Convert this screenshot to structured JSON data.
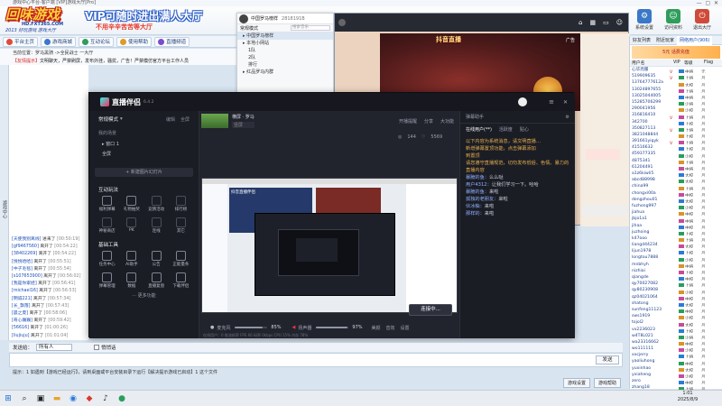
{
  "window": {
    "title": "游戏中心平台-客户端  [VIP]游戏大厅[Pro]"
  },
  "banner": {
    "logo_main": "回味游戏",
    "logo_url": "HD.FXT365.COM",
    "logo_slogan": "2013 好玩游戏 游戏大厅",
    "vip_line1": "VIP可随时进出满人大厅",
    "vip_line2": "不用辛辛苦苦等大厅"
  },
  "top_right": [
    {
      "label": "系统设置",
      "icon": "gear-icon",
      "color": "#3a78c8"
    },
    {
      "label": "访问资料",
      "icon": "user-icon",
      "color": "#2f9d5b"
    },
    {
      "label": "退出大厅",
      "icon": "exit-icon",
      "color": "#d04a3a"
    }
  ],
  "toolbar": [
    {
      "label": "平台主页",
      "color": "#e04a3a"
    },
    {
      "label": "游戏商城",
      "color": "#3a78c8"
    },
    {
      "label": "互动论坛",
      "color": "#2f9d5b"
    },
    {
      "label": "使用帮助",
      "color": "#e09a2a"
    },
    {
      "label": "直播频道",
      "color": "#7a4ad0"
    }
  ],
  "announce": {
    "prefix": "当前位置：",
    "location": "罗马黑骑 ->全民战士 一大厅",
    "notice_tag": "【友情提示】",
    "notice": "文明聊天，严禁刷屏，发布外挂，骚扰，广告！严禁模仿官方平台工作人员"
  },
  "left_label": "游戏中心",
  "chat_log": [
    {
      "name": "[天使我别离线]",
      "action": "进来了",
      "time": "[00:50:19]"
    },
    {
      "name": "[gf9467560]",
      "action": "离开了",
      "time": "[00:54:22]"
    },
    {
      "name": "[38402269]",
      "action": "离开了",
      "time": "[00:54:22]"
    },
    {
      "name": "[悦悦哈哈]",
      "action": "离开了",
      "time": "[00:55:51]"
    },
    {
      "name": "[中子毛毯]",
      "action": "离开了",
      "time": "[00:55:54]"
    },
    {
      "name": "[s107653900]",
      "action": "离开了",
      "time": "[00:56:02]"
    },
    {
      "name": "[我是你家娃]",
      "action": "离开了",
      "time": "[00:56:41]"
    },
    {
      "name": "[michael16]",
      "action": "离开了",
      "time": "[00:56:53]"
    },
    {
      "name": "[明诚221]",
      "action": "离开了",
      "time": "[00:57:34]"
    },
    {
      "name": "[长_飘落]",
      "action": "离开了",
      "time": "[00:57:43]"
    },
    {
      "name": "[晨之夏]",
      "action": "离开了",
      "time": "[00:58:06]"
    },
    {
      "name": "[奇心巍巍]",
      "action": "离开了",
      "time": "[00:59:42]"
    },
    {
      "name": "[56616]",
      "action": "离开了",
      "time": "[01:00:26]"
    },
    {
      "name": "[liujiuju]",
      "action": "离开了",
      "time": "[01:01:04]"
    }
  ],
  "send": {
    "label": "发送给：",
    "target": "所有人",
    "checkbox_label": "悄悄话",
    "send_label": "发送"
  },
  "tip": "提示：1 如遇到【游戏已经运行】，请到桌面或平台安装目录下运行【解决提示游戏已启动】1 这个文件",
  "game_buttons": [
    "游戏设置",
    "游戏帮助"
  ],
  "clock": {
    "time": "1:01",
    "date": "2025/8/9"
  },
  "user_panel": {
    "tabs": [
      "好友列表",
      "附近玩家",
      "网络用户(906)"
    ],
    "active_tab": 2,
    "ad_text": "5元 话费充值",
    "headers": [
      "用户名",
      "VIP",
      "等级",
      "Flag"
    ],
    "users": [
      {
        "name": "心华亮服",
        "vip": "V",
        "level": "中将",
        "extra": "无"
      },
      {
        "name": "519909635",
        "vip": "V",
        "level": "上将",
        "extra": "月"
      },
      {
        "name": "13764777612a",
        "vip": "",
        "level": "大校",
        "extra": "月"
      },
      {
        "name": "13024897655",
        "vip": "",
        "level": "上将",
        "extra": "月"
      },
      {
        "name": "13025044005",
        "vip": "",
        "level": "中将",
        "extra": "月"
      },
      {
        "name": "15285706299",
        "vip": "",
        "level": "少将",
        "extra": "月"
      },
      {
        "name": "290041956",
        "vip": "",
        "level": "少校",
        "extra": "月"
      },
      {
        "name": "316816410",
        "vip": "V",
        "level": "上将",
        "extra": "月"
      },
      {
        "name": "342700",
        "vip": "",
        "level": "上校",
        "extra": "月"
      },
      {
        "name": "350827113",
        "vip": "V",
        "level": "上将",
        "extra": "月"
      },
      {
        "name": "3821048844",
        "vip": "",
        "level": "上校",
        "extra": "月"
      },
      {
        "name": "391661yiqyk",
        "vip": "V",
        "level": "上将",
        "extra": "月"
      },
      {
        "name": "41516632",
        "vip": "",
        "level": "上校",
        "extra": "月"
      },
      {
        "name": "459377335",
        "vip": "",
        "level": "少校",
        "extra": "月"
      },
      {
        "name": "4875341",
        "vip": "",
        "level": "上将",
        "extra": "月"
      },
      {
        "name": "61204491",
        "vip": "",
        "level": "中将",
        "extra": "月"
      },
      {
        "name": "a1z6kiwli5",
        "vip": "",
        "level": "大校",
        "extra": "月"
      },
      {
        "name": "abcd88998",
        "vip": "",
        "level": "大校",
        "extra": "月"
      },
      {
        "name": "china99",
        "vip": "",
        "level": "上将",
        "extra": "月"
      },
      {
        "name": "chongxi00a",
        "vip": "",
        "level": "中校",
        "extra": "月"
      },
      {
        "name": "dengzhou01",
        "vip": "",
        "level": "大校",
        "extra": "月"
      },
      {
        "name": "fuzhong997",
        "vip": "",
        "level": "少校",
        "extra": "月"
      },
      {
        "name": "jiahua",
        "vip": "",
        "level": "中校",
        "extra": "月"
      },
      {
        "name": "jbjo1a1",
        "vip": "",
        "level": "中将",
        "extra": "月"
      },
      {
        "name": "jihaa",
        "vip": "",
        "level": "中校",
        "extra": "月"
      },
      {
        "name": "juzhoing",
        "vip": "",
        "level": "上校",
        "extra": "月"
      },
      {
        "name": "k47ooo",
        "vip": "",
        "level": "上将",
        "extra": "月"
      },
      {
        "name": "liangd44234",
        "vip": "",
        "level": "大校",
        "extra": "月"
      },
      {
        "name": "lijun1978",
        "vip": "",
        "level": "上校",
        "extra": "月"
      },
      {
        "name": "longtou7888",
        "vip": "",
        "level": "少校",
        "extra": "月"
      },
      {
        "name": "mnbhyh",
        "vip": "",
        "level": "中将",
        "extra": "月"
      },
      {
        "name": "nizhiai",
        "vip": "",
        "level": "上校",
        "extra": "月"
      },
      {
        "name": "qiangde",
        "vip": "",
        "level": "中校",
        "extra": "月"
      },
      {
        "name": "qy70027082",
        "vip": "",
        "level": "上将",
        "extra": "月"
      },
      {
        "name": "qy80230908",
        "vip": "",
        "level": "少校",
        "extra": "月"
      },
      {
        "name": "qz04021064",
        "vip": "",
        "level": "中校",
        "extra": "月"
      },
      {
        "name": "shatong",
        "vip": "",
        "level": "大校",
        "extra": "月"
      },
      {
        "name": "sunfeng11123",
        "vip": "",
        "level": "中校",
        "extra": "月"
      },
      {
        "name": "sws1919",
        "vip": "",
        "level": "少校",
        "extra": "月"
      },
      {
        "name": "tojol2",
        "vip": "",
        "level": "大校",
        "extra": "月"
      },
      {
        "name": "vx2236023",
        "vip": "",
        "level": "上校",
        "extra": "月"
      },
      {
        "name": "w4T8L021",
        "vip": "",
        "level": "少将",
        "extra": "月"
      },
      {
        "name": "wa23316662",
        "vip": "",
        "level": "中校",
        "extra": "月"
      },
      {
        "name": "wo111111",
        "vip": "",
        "level": "少校",
        "extra": "月"
      },
      {
        "name": "xxcjerry",
        "vip": "",
        "level": "上将",
        "extra": "月"
      },
      {
        "name": "yaoliuhong",
        "vip": "",
        "level": "中校",
        "extra": "月"
      },
      {
        "name": "yuxinhao",
        "vip": "",
        "level": "大校",
        "extra": "月"
      },
      {
        "name": "yxiaheng",
        "vip": "",
        "level": "少校",
        "extra": "月"
      },
      {
        "name": "zero",
        "vip": "",
        "level": "中校",
        "extra": "月"
      },
      {
        "name": "zhang18",
        "vip": "",
        "level": "上将",
        "extra": "月"
      },
      {
        "name": "zhouhao",
        "vip": "",
        "level": "少校",
        "extra": "月"
      }
    ]
  },
  "music": {
    "title": "中国罗马榜样",
    "id": "2818191B",
    "filter": "常规模式",
    "search_placeholder": "搜索音乐",
    "items": [
      {
        "label": "中国罗马榜样",
        "sub": false,
        "sel": true
      },
      {
        "label": "本地小网站",
        "sub": false,
        "sel": false
      },
      {
        "label": "1队",
        "sub": true,
        "sel": false
      },
      {
        "label": "2队",
        "sub": true,
        "sel": false
      },
      {
        "label": "排行",
        "sub": true,
        "sel": false
      },
      {
        "label": "红品罗马内群",
        "sub": false,
        "sel": false
      }
    ]
  },
  "game_window": {
    "tab_label": "广告",
    "art_text": "抖音直播"
  },
  "stream": {
    "app_name": "直播伴侣",
    "version": "6.4.2",
    "mode": "常规模式",
    "edit_label": "编辑",
    "full_label": "全屏",
    "scene_header": "我的场景",
    "scenes": [
      "窗口 1",
      "全屏"
    ],
    "new_scene": "+ 新建图片幻灯片",
    "interact_header": "互动玩法",
    "interact_tools": [
      "福利弹幕",
      "礼物抽奖",
      "竞猜活动",
      "排行榜",
      "神秘商店",
      "PK",
      "连线",
      "其它"
    ],
    "base_header": "基础工具",
    "base_tools": [
      "任务中心",
      "AI助手",
      "公告",
      "正能量条",
      "弹幕管理",
      "数据",
      "直播复盘",
      "下载伴侣"
    ],
    "more": "··· 更多功能",
    "scene_tabs": [
      "横屏 · 罗马",
      "竖屏"
    ],
    "stats": [
      "开播提醒",
      "分享",
      "大功能"
    ],
    "preview_label": "抖音直播伴侣",
    "counts": {
      "viewers": "144",
      "likes": "5569"
    },
    "audio": {
      "mic_label": "麦克风",
      "mic": "85%",
      "spk_label": "扬声器",
      "spk": "97%"
    },
    "bottom_icons": [
      "美颜",
      "音效",
      "设置"
    ],
    "status": "在线用户：0  推流帧率  FPS 60  码率 0kbps  CPU 15%  内存 78%",
    "live_button": "连接中...",
    "danmaku_header": "弹幕助手",
    "danmaku_tabs": [
      "在线用户(**)",
      "活跃度",
      "贴心"
    ],
    "danmaku_lines": [
      {
        "type": "notice",
        "text": "以下内容为系统消息，请文明直播…"
      },
      {
        "type": "notice",
        "text": "新增弹幕置顶功能，点击弹幕添加"
      },
      {
        "type": "notice",
        "text": "到置顶"
      },
      {
        "type": "notice",
        "text": "请您遵守直播规范，切勿发布低俗、色情、暴力的直播内容"
      },
      {
        "type": "user",
        "name": "暴脆的鱼",
        "text": "么么哒"
      },
      {
        "type": "user",
        "name": "用户4312",
        "text": "让我们学习一下。哈哈"
      },
      {
        "type": "user",
        "name": "暴脆的鱼",
        "text": "来啦"
      },
      {
        "type": "user",
        "name": "孤独的老朋友",
        "text": "来啦"
      },
      {
        "type": "user",
        "name": "伙冰柚",
        "text": "来啦"
      },
      {
        "type": "user",
        "name": "那样的",
        "text": "来啦"
      }
    ]
  }
}
